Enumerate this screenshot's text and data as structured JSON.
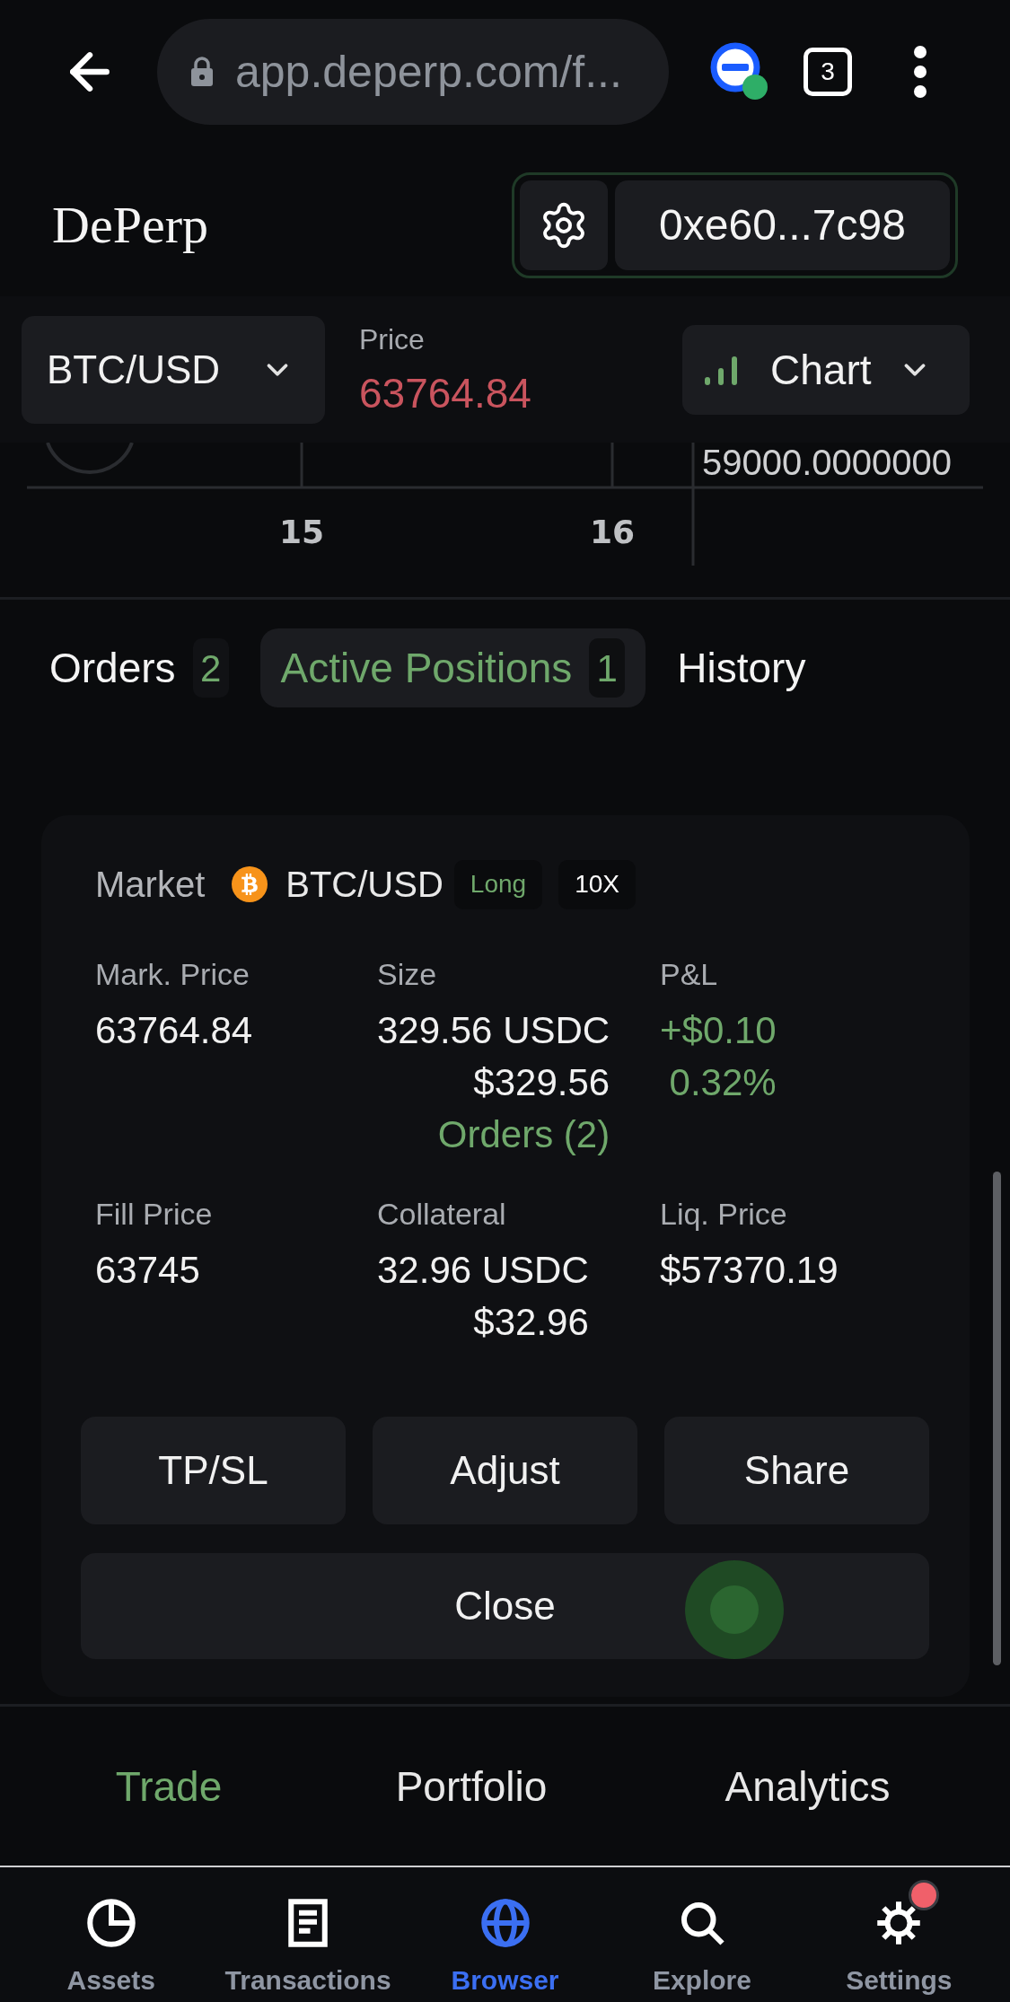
{
  "browser_bar": {
    "url": "app.deperp.com/f...",
    "tab_count": "3"
  },
  "header": {
    "logo": "DePerp",
    "wallet_address": "0xe60...7c98"
  },
  "market_bar": {
    "pair": "BTC/USD",
    "price_label": "Price",
    "price": "63764.84",
    "falling": true,
    "view": "Chart"
  },
  "chart_fragment": {
    "price_axis_label": "59000.0000000",
    "date_axis_labels": [
      "15",
      "16"
    ]
  },
  "tabs": [
    {
      "label": "Orders",
      "count": "2",
      "selected": false
    },
    {
      "label": "Active Positions",
      "count": "1",
      "selected": true
    },
    {
      "label": "History",
      "selected": false
    }
  ],
  "position": {
    "market_label": "Market",
    "pair": "BTC/USD",
    "side": {
      "label": "Long",
      "kind": "long"
    },
    "leverage": "10X",
    "fields": [
      {
        "label": "Mark. Price",
        "values": [
          {
            "text": "63764.84",
            "kind": "plain"
          }
        ]
      },
      {
        "label": "Size",
        "values": [
          {
            "text": "329.56 USDC",
            "kind": "plain"
          },
          {
            "text": "$329.56",
            "kind": "plain"
          },
          {
            "text": "Orders (2)",
            "kind": "link"
          }
        ]
      },
      {
        "label": "P&L",
        "values": [
          {
            "text": "+$0.10",
            "kind": "gain"
          },
          {
            "text": "0.32%",
            "kind": "gain"
          }
        ]
      },
      {
        "label": "Fill Price",
        "values": [
          {
            "text": "63745",
            "kind": "plain"
          }
        ]
      },
      {
        "label": "Collateral",
        "values": [
          {
            "text": "32.96 USDC",
            "kind": "plain"
          },
          {
            "text": "$32.96",
            "kind": "plain"
          }
        ]
      },
      {
        "label": "Liq. Price",
        "values": [
          {
            "text": "$57370.19",
            "kind": "plain"
          }
        ]
      }
    ],
    "actions": [
      "TP/SL",
      "Adjust",
      "Share"
    ],
    "close_button": "Close"
  },
  "page_tabs": [
    {
      "label": "Trade",
      "selected": true
    },
    {
      "label": "Portfolio",
      "selected": false
    },
    {
      "label": "Analytics",
      "selected": false
    }
  ],
  "system_nav": [
    {
      "kind": "assets",
      "label": "Assets",
      "selected": false,
      "notification": false
    },
    {
      "kind": "transactions",
      "label": "Transactions",
      "selected": false,
      "notification": false
    },
    {
      "kind": "browser",
      "label": "Browser",
      "selected": true,
      "notification": false
    },
    {
      "kind": "explore",
      "label": "Explore",
      "selected": false,
      "notification": false
    },
    {
      "kind": "settings",
      "label": "Settings",
      "selected": false,
      "notification": true
    }
  ]
}
